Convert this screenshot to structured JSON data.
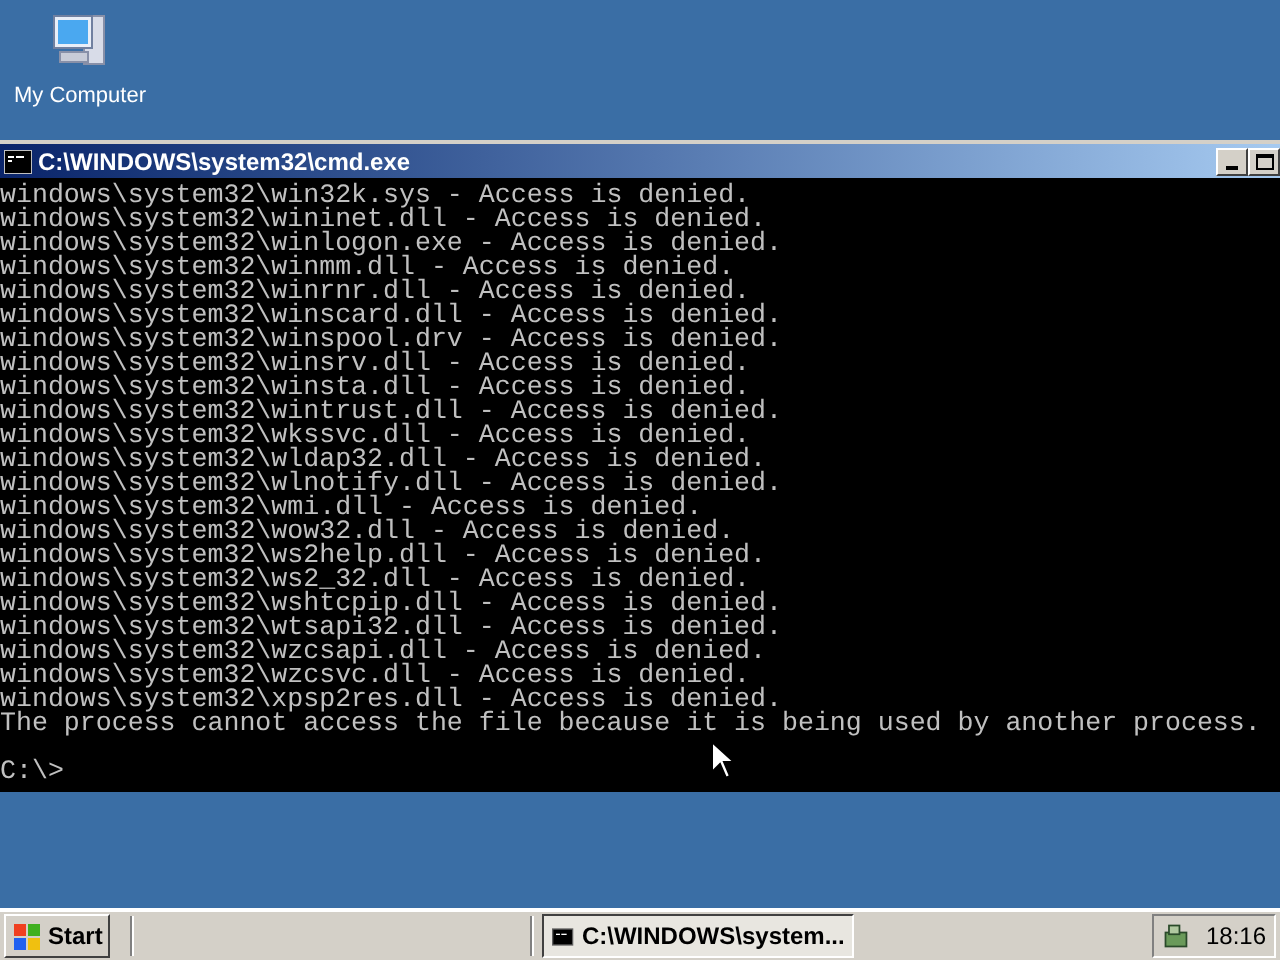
{
  "desktop_icons": [
    {
      "label": "My Computer"
    }
  ],
  "window": {
    "title": "C:\\WINDOWS\\system32\\cmd.exe",
    "lines": [
      "windows\\system32\\win32k.sys - Access is denied.",
      "windows\\system32\\wininet.dll - Access is denied.",
      "windows\\system32\\winlogon.exe - Access is denied.",
      "windows\\system32\\winmm.dll - Access is denied.",
      "windows\\system32\\winrnr.dll - Access is denied.",
      "windows\\system32\\winscard.dll - Access is denied.",
      "windows\\system32\\winspool.drv - Access is denied.",
      "windows\\system32\\winsrv.dll - Access is denied.",
      "windows\\system32\\winsta.dll - Access is denied.",
      "windows\\system32\\wintrust.dll - Access is denied.",
      "windows\\system32\\wkssvc.dll - Access is denied.",
      "windows\\system32\\wldap32.dll - Access is denied.",
      "windows\\system32\\wlnotify.dll - Access is denied.",
      "windows\\system32\\wmi.dll - Access is denied.",
      "windows\\system32\\wow32.dll - Access is denied.",
      "windows\\system32\\ws2help.dll - Access is denied.",
      "windows\\system32\\ws2_32.dll - Access is denied.",
      "windows\\system32\\wshtcpip.dll - Access is denied.",
      "windows\\system32\\wtsapi32.dll - Access is denied.",
      "windows\\system32\\wzcsapi.dll - Access is denied.",
      "windows\\system32\\wzcsvc.dll - Access is denied.",
      "windows\\system32\\xpsp2res.dll - Access is denied.",
      "The process cannot access the file because it is being used by another process."
    ],
    "prompt": "C:\\>"
  },
  "taskbar": {
    "start": "Start",
    "tasks": [
      {
        "label": "C:\\WINDOWS\\system...",
        "selected": true
      }
    ],
    "clock": "18:16"
  }
}
